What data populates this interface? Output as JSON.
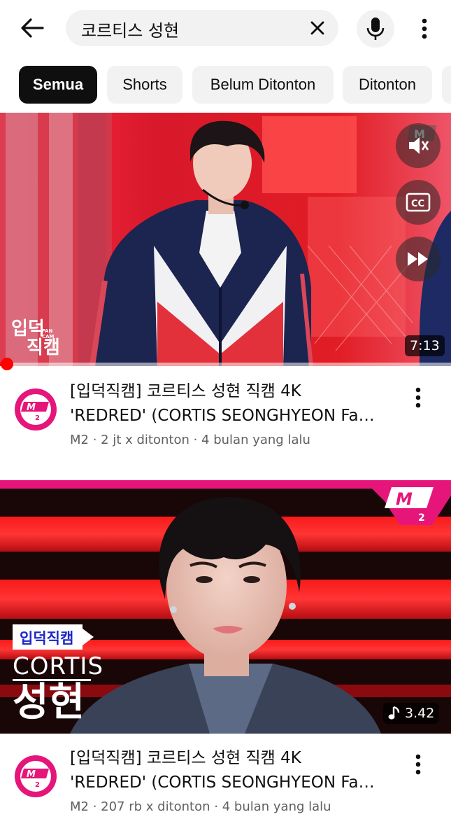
{
  "search": {
    "query": "코르티스 성현",
    "back_icon": "arrow-left-icon",
    "clear_icon": "close-icon",
    "mic_icon": "microphone-icon",
    "more_icon": "more-vert-icon"
  },
  "chips": [
    {
      "label": "Semua",
      "active": true
    },
    {
      "label": "Shorts",
      "active": false
    },
    {
      "label": "Belum Ditonton",
      "active": false
    },
    {
      "label": "Ditonton",
      "active": false
    }
  ],
  "videos": [
    {
      "title_line1": "[입덕직캠] 코르티스 성현 직캠 4K",
      "title_line2": "'REDRED' (CORTIS SEONGHYEON Fa…",
      "channel": "M2",
      "views": "2 jt x ditonton",
      "age": "4 bulan yang lalu",
      "duration": "7:13",
      "thumb_logo_line1": "입덕",
      "thumb_logo_line2": "직캠",
      "thumb_logo_tag": "FAN CAM",
      "controls": [
        "volume-off-icon",
        "closed-caption-icon",
        "fast-forward-icon"
      ],
      "playback_progress": 0.015
    },
    {
      "title_line1": "[입덕직캠] 코르티스 성현 직캠 4K",
      "title_line2": "'REDRED' (CORTIS SEONGHYEON Fa…",
      "channel": "M2",
      "views": "207 rb x ditonton",
      "age": "4 bulan yang lalu",
      "duration": "3.42",
      "thumb_badge": "입덕직캠",
      "thumb_group": "CORTIS",
      "thumb_name": "성현",
      "duration_icon": "music-note-icon"
    }
  ],
  "colors": {
    "accent_red": "#ff0000",
    "brand_pink": "#e6157a",
    "chip_bg": "#f2f2f2",
    "chip_active_bg": "#0f0f0f",
    "secondary_text": "#606060"
  }
}
